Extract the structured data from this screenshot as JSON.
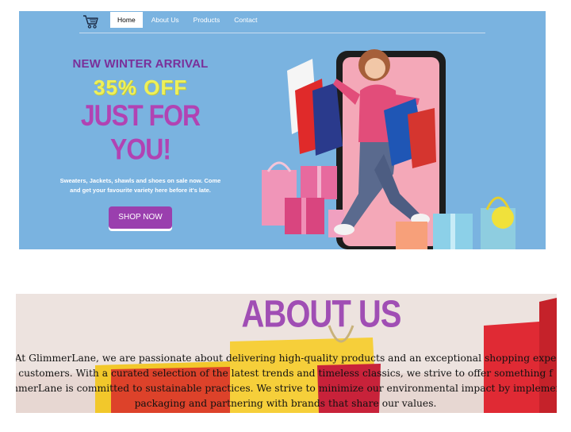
{
  "nav": {
    "links": [
      "Home",
      "About Us",
      "Products",
      "Contact"
    ]
  },
  "hero": {
    "arrival": "NEW WINTER ARRIVAL",
    "discount": "35% OFF",
    "headline": "JUST FOR YOU!",
    "description": "Sweaters, Jackets, shawls and shoes on sale now. Come and get your favourite variety here before it's late.",
    "cta_label": "SHOP NOW"
  },
  "about": {
    "title": "ABOUT US",
    "lines": [
      "At GlimmerLane, we are passionate about delivering high-quality products and an exceptional shopping expe",
      "customers. With a curated selection of the latest trends and timeless classics, we strive to offer something f",
      "mmerLane is committed to sustainable practices. We strive to minimize our environmental impact by implemen",
      "packaging and partnering with brands that share our values."
    ]
  },
  "colors": {
    "hero_bg": "#7ab3e0",
    "accent_purple": "#9a3fae",
    "discount_yellow": "#eef05a"
  }
}
